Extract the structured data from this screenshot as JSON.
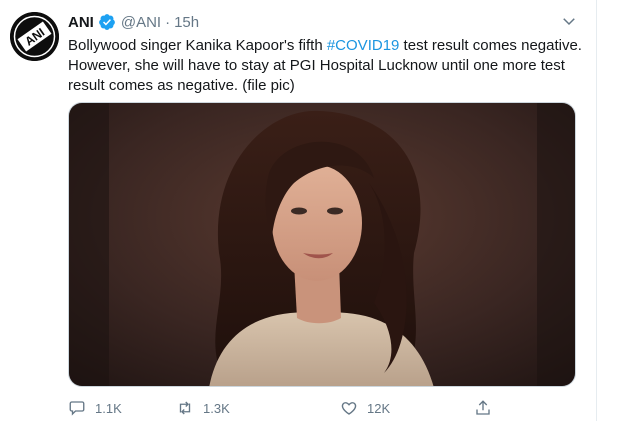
{
  "tweet": {
    "author_name": "ANI",
    "handle": "@ANI",
    "separator": "·",
    "time": "15h",
    "text_before": "Bollywood singer Kanika Kapoor's fifth ",
    "hashtag": "#COVID19",
    "text_after": " test result comes negative. However, she will have to stay at PGI Hospital Lucknow until one more test result comes as negative. (file pic)",
    "avatar_logo_text": "ANI",
    "icons": {
      "verified": "verified-badge-icon",
      "caret": "chevron-down-icon",
      "reply": "reply-icon",
      "retweet": "retweet-icon",
      "like": "heart-icon",
      "share": "share-icon"
    }
  },
  "actions": {
    "reply_count": "1.1K",
    "retweet_count": "1.3K",
    "like_count": "12K"
  },
  "colors": {
    "link": "#1b95e0",
    "verified": "#1da1f2",
    "secondary_text": "#657786"
  }
}
